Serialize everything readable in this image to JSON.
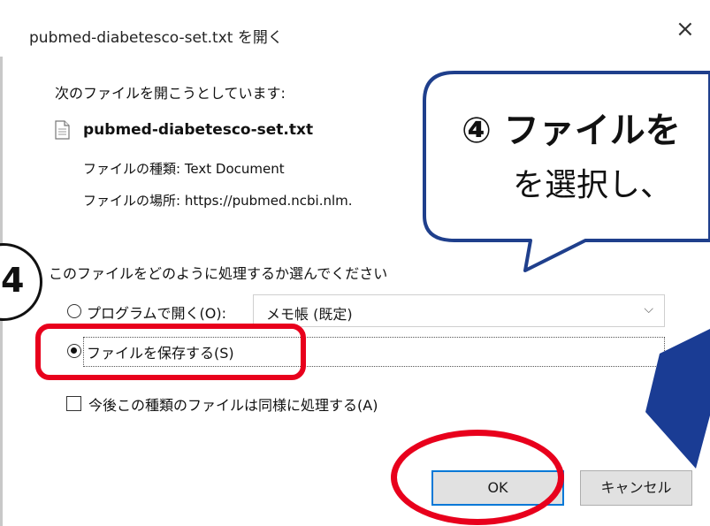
{
  "dialog": {
    "title": "pubmed-diabetesco-set.txt を開く",
    "close_glyph": "×",
    "intro": "次のファイルを開こうとしています:",
    "file_name": "pubmed-diabetesco-set.txt",
    "type_line": "ファイルの種類: Text Document",
    "location_line": "ファイルの場所: https://pubmed.ncbi.nlm.",
    "question": "このファイルをどのように処理するか選んでください",
    "option_open_label": "プログラムで開く(O):",
    "program_value": "メモ帳 (既定)",
    "option_save_label": "ファイルを保存する(S)",
    "remember_label": "今後この種類のファイルは同様に処理する(A)",
    "ok_label": "OK",
    "cancel_label": "キャンセル"
  },
  "annotation": {
    "step_badge": "4",
    "callout_line1": "④ ファイルを",
    "callout_line2": "を選択し、",
    "highlight_color": "#e8001c",
    "arrow_color": "#1a3c94"
  },
  "icons": {
    "file": "text-file-icon",
    "close": "close-icon",
    "dropdown": "chevron-down-icon"
  }
}
